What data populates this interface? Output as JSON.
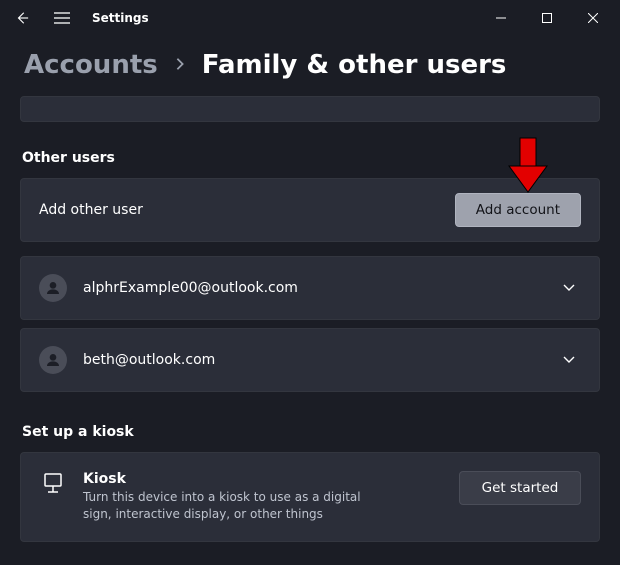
{
  "titlebar": {
    "title": "Settings"
  },
  "breadcrumb": {
    "parent": "Accounts",
    "separator": "›",
    "current": "Family & other users"
  },
  "other_users": {
    "section_label": "Other users",
    "add_row_label": "Add other user",
    "add_button_label": "Add account",
    "accounts": [
      {
        "email": "alphrExample00@outlook.com"
      },
      {
        "email": "beth@outlook.com"
      }
    ]
  },
  "kiosk": {
    "section_label": "Set up a kiosk",
    "title": "Kiosk",
    "description": "Turn this device into a kiosk to use as a digital sign, interactive display, or other things",
    "button_label": "Get started"
  }
}
